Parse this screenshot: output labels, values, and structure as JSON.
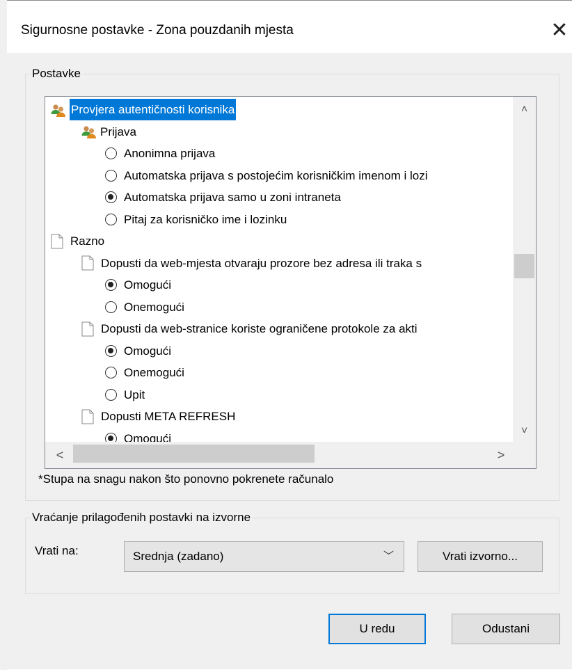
{
  "dialog": {
    "title": "Sigurnosne postavke - Zona pouzdanih mjesta",
    "close_glyph": "✕"
  },
  "settings": {
    "legend": "Postavke",
    "tree": [
      {
        "type": "category",
        "icon": "users-icon",
        "label": "Provjera autentičnosti korisnika",
        "selected": true
      },
      {
        "type": "subcategory",
        "icon": "users-icon",
        "label": "Prijava"
      },
      {
        "type": "radio",
        "label": "Anonimna prijava",
        "checked": false
      },
      {
        "type": "radio",
        "label": "Automatska prijava s postojećim korisničkim imenom i lozi",
        "checked": false
      },
      {
        "type": "radio",
        "label": "Automatska prijava samo u zoni intraneta",
        "checked": true
      },
      {
        "type": "radio",
        "label": "Pitaj za korisničko ime i lozinku",
        "checked": false
      },
      {
        "type": "category",
        "icon": "document-icon",
        "label": "Razno"
      },
      {
        "type": "subcategory",
        "icon": "document-icon",
        "label": "Dopusti da web-mjesta otvaraju prozore bez adresa ili traka s"
      },
      {
        "type": "radio",
        "label": "Omogući",
        "checked": true
      },
      {
        "type": "radio",
        "label": "Onemogući",
        "checked": false
      },
      {
        "type": "subcategory",
        "icon": "document-icon",
        "label": "Dopusti da web-stranice koriste ograničene protokole za akti"
      },
      {
        "type": "radio",
        "label": "Omogući",
        "checked": true
      },
      {
        "type": "radio",
        "label": "Onemogući",
        "checked": false
      },
      {
        "type": "radio",
        "label": "Upit",
        "checked": false
      },
      {
        "type": "subcategory",
        "icon": "document-icon",
        "label": "Dopusti META REFRESH"
      },
      {
        "type": "radio",
        "label": "Omogući",
        "checked": true
      }
    ],
    "scroll_up": "˄",
    "scroll_down": "˅",
    "scroll_left": "<",
    "scroll_right": ">",
    "note": "*Stupa na snagu nakon što ponovno pokrenete računalo"
  },
  "reset": {
    "legend": "Vraćanje prilagođenih postavki na izvorne",
    "label": "Vrati na:",
    "selected_option": "Srednja (zadano)",
    "reset_button": "Vrati izvorno..."
  },
  "footer": {
    "ok_label": "U redu",
    "cancel_label": "Odustani"
  },
  "colors": {
    "accent": "#0078d7",
    "icon_green": "#3d9a3d",
    "icon_orange": "#e08a1e"
  }
}
